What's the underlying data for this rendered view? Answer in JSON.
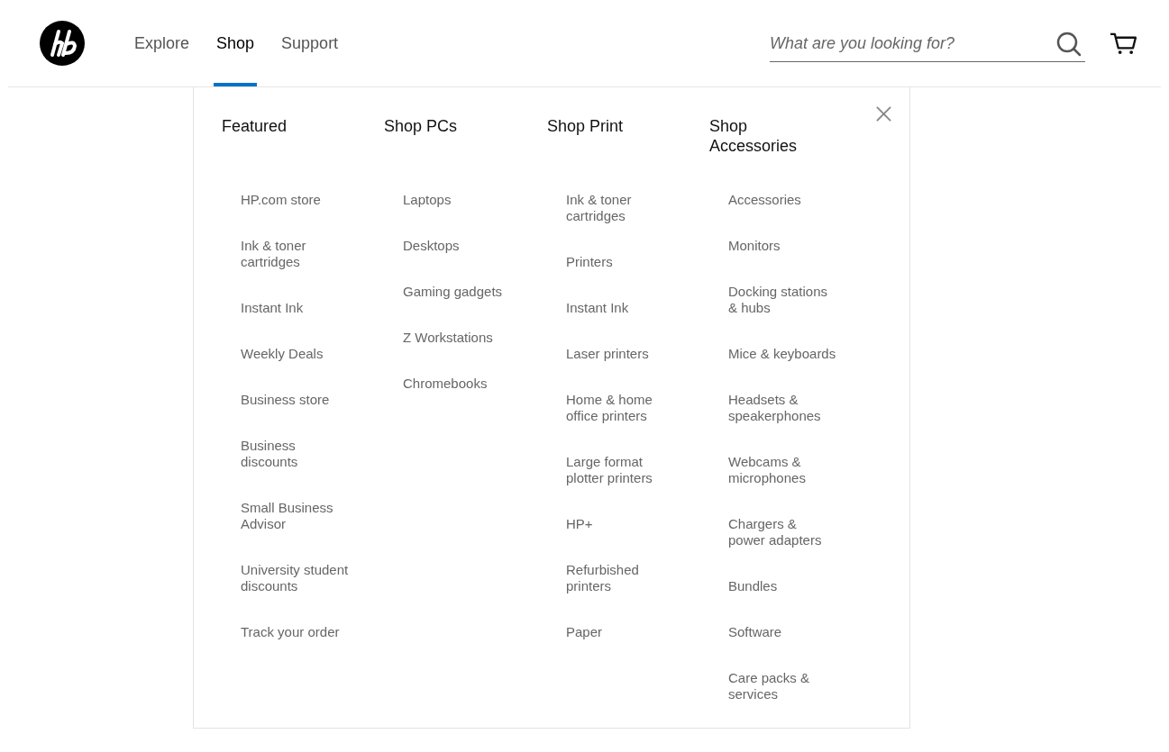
{
  "nav": [
    {
      "label": "Explore",
      "selected": false
    },
    {
      "label": "Shop",
      "selected": true
    },
    {
      "label": "Support",
      "selected": false
    }
  ],
  "search": {
    "placeholder": "What are you looking for?"
  },
  "menu": {
    "columns": [
      {
        "heading": "Featured",
        "items": [
          "HP.com store",
          "Ink & toner cartridges",
          "Instant Ink",
          "Weekly Deals",
          "Business store",
          "Business discounts",
          "Small Business Advisor",
          "University student discounts",
          "Track your order"
        ]
      },
      {
        "heading": "Shop PCs",
        "items": [
          "Laptops",
          "Desktops",
          "Gaming gadgets",
          "Z Workstations",
          "Chromebooks"
        ]
      },
      {
        "heading": "Shop Print",
        "items": [
          "Ink & toner cartridges",
          "Printers",
          "Instant Ink",
          "Laser printers",
          "Home & home office printers",
          "Large format plotter printers",
          "HP+",
          "Refurbished printers",
          "Paper"
        ]
      },
      {
        "heading": "Shop Accessories",
        "items": [
          "Accessories",
          "Monitors",
          "Docking stations & hubs",
          "Mice & keyboards",
          "Headsets & speakerphones",
          "Webcams & microphones",
          "Chargers & power adapters",
          "Bundles",
          "Software",
          "Care packs & services"
        ]
      }
    ]
  }
}
